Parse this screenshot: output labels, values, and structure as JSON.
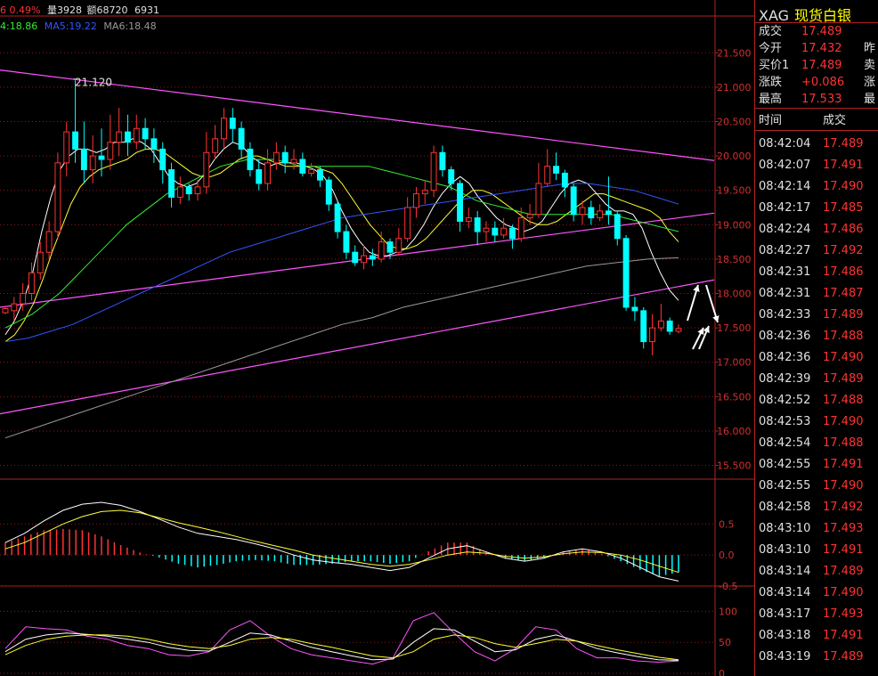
{
  "top_stats": {
    "chg": "6 0.49%",
    "vol": "量3928",
    "amt": "额68720",
    "extra": "6931"
  },
  "ma_line": {
    "ma4": "4:18.86",
    "ma5": "MA5:19.22",
    "ma6": "MA6:18.48"
  },
  "colors": {
    "up": "#ff3333",
    "down": "#00ffff",
    "trend": "#ff55ff",
    "ma_white": "#ffffff",
    "ma_yellow": "#ffff33",
    "ma_green": "#33ee33",
    "ma_blue": "#3355ff",
    "ma_gray": "#999999",
    "grid": "#8b1a1a"
  },
  "quote": {
    "symbol": "XAG",
    "name": "现货白银",
    "rows": [
      {
        "label": "成交",
        "value": "17.489",
        "ext": ""
      },
      {
        "label": "今开",
        "value": "17.432",
        "ext": "昨"
      },
      {
        "label": "买价1",
        "value": "17.489",
        "ext": "卖"
      },
      {
        "label": "涨跌",
        "value": "+0.086",
        "ext": "涨"
      },
      {
        "label": "最高",
        "value": "17.533",
        "ext": "最"
      }
    ]
  },
  "ticks_header": {
    "time": "时间",
    "price": "成交"
  },
  "ticks": [
    {
      "t": "08:42:04",
      "p": "17.489"
    },
    {
      "t": "08:42:07",
      "p": "17.491"
    },
    {
      "t": "08:42:14",
      "p": "17.490"
    },
    {
      "t": "08:42:17",
      "p": "17.485"
    },
    {
      "t": "08:42:24",
      "p": "17.486"
    },
    {
      "t": "08:42:27",
      "p": "17.492"
    },
    {
      "t": "08:42:31",
      "p": "17.486"
    },
    {
      "t": "08:42:31",
      "p": "17.487"
    },
    {
      "t": "08:42:33",
      "p": "17.489"
    },
    {
      "t": "08:42:36",
      "p": "17.488"
    },
    {
      "t": "08:42:36",
      "p": "17.490"
    },
    {
      "t": "08:42:39",
      "p": "17.489"
    },
    {
      "t": "08:42:52",
      "p": "17.488"
    },
    {
      "t": "08:42:53",
      "p": "17.490"
    },
    {
      "t": "08:42:54",
      "p": "17.488"
    },
    {
      "t": "08:42:55",
      "p": "17.491"
    },
    {
      "t": "08:42:55",
      "p": "17.490"
    },
    {
      "t": "08:42:58",
      "p": "17.492"
    },
    {
      "t": "08:43:10",
      "p": "17.493"
    },
    {
      "t": "08:43:10",
      "p": "17.491"
    },
    {
      "t": "08:43:14",
      "p": "17.489"
    },
    {
      "t": "08:43:14",
      "p": "17.490"
    },
    {
      "t": "08:43:17",
      "p": "17.493"
    },
    {
      "t": "08:43:18",
      "p": "17.491"
    },
    {
      "t": "08:43:19",
      "p": "17.489"
    }
  ],
  "chart_data": [
    {
      "type": "candlestick",
      "ylim": [
        15.3,
        21.75
      ],
      "yticks": [
        "21.500",
        "21.000",
        "20.500",
        "20.000",
        "19.500",
        "19.000",
        "18.500",
        "18.000",
        "17.500",
        "17.000",
        "16.500",
        "16.000",
        "15.500"
      ],
      "ytick_values": [
        21.5,
        21.0,
        20.5,
        20.0,
        19.5,
        19.0,
        18.5,
        18.0,
        17.5,
        17.0,
        16.5,
        16.0,
        15.5
      ],
      "annotation": {
        "text": "21.120",
        "value": 21.12
      },
      "candles": [
        [
          17.72,
          17.78,
          17.82,
          17.7
        ],
        [
          17.75,
          17.85,
          17.95,
          17.6
        ],
        [
          17.85,
          18.0,
          18.15,
          17.75
        ],
        [
          18.0,
          18.3,
          18.45,
          17.9
        ],
        [
          18.3,
          18.6,
          18.75,
          18.2
        ],
        [
          18.6,
          18.9,
          19.05,
          18.5
        ],
        [
          18.9,
          19.9,
          20.05,
          18.8
        ],
        [
          19.9,
          20.35,
          20.5,
          19.7
        ],
        [
          20.35,
          20.1,
          21.1,
          19.9
        ],
        [
          20.1,
          19.8,
          20.5,
          19.6
        ],
        [
          19.8,
          20.0,
          20.3,
          19.6
        ],
        [
          20.0,
          19.95,
          20.4,
          19.7
        ],
        [
          19.95,
          20.2,
          20.6,
          19.8
        ],
        [
          20.2,
          20.35,
          20.7,
          20.0
        ],
        [
          20.35,
          20.2,
          20.6,
          20.0
        ],
        [
          20.2,
          20.4,
          20.6,
          20.1
        ],
        [
          20.4,
          20.25,
          20.55,
          20.1
        ],
        [
          20.25,
          20.1,
          20.4,
          19.9
        ],
        [
          20.1,
          19.8,
          20.2,
          19.6
        ],
        [
          19.8,
          19.4,
          19.9,
          19.25
        ],
        [
          19.4,
          19.55,
          19.7,
          19.3
        ],
        [
          19.55,
          19.45,
          19.6,
          19.35
        ],
        [
          19.45,
          19.55,
          19.65,
          19.35
        ],
        [
          19.55,
          20.05,
          20.35,
          19.45
        ],
        [
          20.05,
          20.25,
          20.45,
          19.95
        ],
        [
          20.25,
          20.55,
          20.7,
          20.1
        ],
        [
          20.55,
          20.4,
          20.7,
          20.2
        ],
        [
          20.4,
          20.1,
          20.5,
          19.95
        ],
        [
          20.1,
          19.8,
          20.2,
          19.7
        ],
        [
          19.8,
          19.6,
          19.95,
          19.5
        ],
        [
          19.6,
          19.9,
          20.1,
          19.5
        ],
        [
          19.9,
          20.05,
          20.2,
          19.8
        ],
        [
          20.05,
          19.9,
          20.15,
          19.75
        ],
        [
          19.9,
          19.95,
          20.1,
          19.8
        ],
        [
          19.95,
          19.75,
          20.05,
          19.7
        ],
        [
          19.75,
          19.8,
          19.9,
          19.7
        ],
        [
          19.8,
          19.65,
          19.85,
          19.55
        ],
        [
          19.65,
          19.3,
          19.7,
          19.2
        ],
        [
          19.3,
          18.9,
          19.35,
          18.8
        ],
        [
          18.9,
          18.6,
          19.0,
          18.5
        ],
        [
          18.6,
          18.45,
          18.7,
          18.4
        ],
        [
          18.45,
          18.55,
          18.7,
          18.35
        ],
        [
          18.55,
          18.5,
          18.65,
          18.4
        ],
        [
          18.5,
          18.75,
          18.9,
          18.45
        ],
        [
          18.75,
          18.6,
          18.8,
          18.5
        ],
        [
          18.6,
          18.8,
          18.95,
          18.55
        ],
        [
          18.8,
          19.25,
          19.4,
          18.75
        ],
        [
          19.25,
          19.45,
          19.55,
          19.1
        ],
        [
          19.45,
          19.5,
          19.65,
          19.3
        ],
        [
          19.5,
          20.05,
          20.15,
          19.4
        ],
        [
          20.05,
          19.8,
          20.15,
          19.7
        ],
        [
          19.8,
          19.6,
          19.85,
          19.5
        ],
        [
          19.6,
          19.05,
          19.65,
          18.9
        ],
        [
          19.05,
          19.1,
          19.25,
          18.95
        ],
        [
          19.1,
          18.9,
          19.2,
          18.7
        ],
        [
          18.9,
          18.95,
          19.05,
          18.75
        ],
        [
          18.95,
          18.85,
          19.05,
          18.75
        ],
        [
          18.85,
          18.95,
          19.1,
          18.8
        ],
        [
          18.95,
          18.8,
          19.0,
          18.65
        ],
        [
          18.8,
          19.1,
          19.25,
          18.75
        ],
        [
          19.1,
          19.15,
          19.3,
          19.0
        ],
        [
          19.15,
          19.6,
          19.9,
          19.1
        ],
        [
          19.6,
          19.85,
          20.1,
          19.55
        ],
        [
          19.85,
          19.75,
          20.05,
          19.65
        ],
        [
          19.75,
          19.55,
          19.8,
          19.4
        ],
        [
          19.55,
          19.15,
          19.6,
          19.05
        ],
        [
          19.15,
          19.25,
          19.35,
          19.0
        ],
        [
          19.25,
          19.1,
          19.35,
          19.0
        ],
        [
          19.1,
          19.2,
          19.3,
          19.05
        ],
        [
          19.2,
          19.15,
          19.7,
          19.0
        ],
        [
          19.15,
          18.8,
          19.2,
          18.7
        ],
        [
          18.8,
          17.8,
          18.85,
          17.75
        ],
        [
          17.8,
          17.75,
          17.95,
          17.6
        ],
        [
          17.75,
          17.3,
          17.8,
          17.2
        ],
        [
          17.3,
          17.5,
          17.7,
          17.1
        ],
        [
          17.5,
          17.6,
          17.85,
          17.45
        ],
        [
          17.6,
          17.45,
          17.65,
          17.4
        ],
        [
          17.45,
          17.49,
          17.55,
          17.42
        ]
      ],
      "ma_series": [
        {
          "values": [
            17.4,
            17.6,
            17.9,
            18.3,
            18.9,
            19.4,
            19.8,
            20.0,
            20.1,
            20.1,
            20.05,
            20.1,
            20.2,
            20.2,
            20.25,
            20.2,
            20.1,
            19.9,
            19.7,
            19.6,
            19.55,
            19.6,
            19.75,
            19.95,
            20.1,
            20.2,
            20.15,
            20.0,
            19.9,
            19.85,
            19.9,
            19.9,
            19.9,
            19.85,
            19.8,
            19.7,
            19.5,
            19.2,
            18.95,
            18.75,
            18.6,
            18.55,
            18.55,
            18.6,
            18.65,
            18.8,
            19.0,
            19.25,
            19.45,
            19.6,
            19.7,
            19.6,
            19.4,
            19.25,
            19.1,
            19.0,
            18.95,
            18.9,
            18.95,
            19.05,
            19.25,
            19.45,
            19.6,
            19.65,
            19.6,
            19.45,
            19.3,
            19.2,
            19.2,
            19.15,
            18.95,
            18.6,
            18.3,
            18.05,
            17.9
          ]
        },
        {
          "values": [
            17.3,
            17.4,
            17.6,
            17.85,
            18.2,
            18.6,
            18.95,
            19.3,
            19.55,
            19.7,
            19.8,
            19.85,
            19.9,
            19.95,
            20.05,
            20.1,
            20.1,
            20.05,
            19.95,
            19.85,
            19.75,
            19.7,
            19.7,
            19.75,
            19.85,
            19.95,
            20.0,
            20.0,
            19.95,
            19.9,
            19.85,
            19.85,
            19.85,
            19.85,
            19.8,
            19.75,
            19.6,
            19.4,
            19.2,
            19.0,
            18.85,
            18.7,
            18.65,
            18.65,
            18.7,
            18.8,
            18.95,
            19.1,
            19.25,
            19.4,
            19.5,
            19.5,
            19.45,
            19.35,
            19.25,
            19.15,
            19.05,
            19.0,
            19.0,
            19.05,
            19.15,
            19.25,
            19.35,
            19.45,
            19.45,
            19.4,
            19.35,
            19.3,
            19.25,
            19.2,
            19.1,
            18.9,
            18.75
          ]
        },
        {
          "values": [
            17.5,
            17.6,
            17.7,
            17.85,
            18.0,
            18.2,
            18.4,
            18.6,
            18.8,
            19.0,
            19.15,
            19.3,
            19.45,
            19.55,
            19.65,
            19.75,
            19.85,
            19.9,
            19.95,
            19.95,
            19.95,
            19.9,
            19.85,
            19.85,
            19.85,
            19.85,
            19.85,
            19.85,
            19.8,
            19.75,
            19.7,
            19.65,
            19.6,
            19.55,
            19.45,
            19.35,
            19.3,
            19.25,
            19.2,
            19.15,
            19.15,
            19.15,
            19.15,
            19.15,
            19.15,
            19.15,
            19.1,
            19.05,
            19.0,
            18.95,
            18.9
          ]
        },
        {
          "values": [
            17.3,
            17.35,
            17.45,
            17.55,
            17.7,
            17.85,
            18.0,
            18.15,
            18.3,
            18.45,
            18.6,
            18.7,
            18.8,
            18.9,
            19.0,
            19.1,
            19.15,
            19.2,
            19.25,
            19.3,
            19.35,
            19.4,
            19.45,
            19.5,
            19.55,
            19.6,
            19.6,
            19.55,
            19.5,
            19.4,
            19.3
          ]
        },
        {
          "values": [
            15.9,
            16.05,
            16.2,
            16.35,
            16.5,
            16.65,
            16.8,
            16.95,
            17.1,
            17.25,
            17.4,
            17.55,
            17.65,
            17.8,
            17.9,
            18.0,
            18.1,
            18.2,
            18.3,
            18.4,
            18.45,
            18.5,
            18.52
          ]
        }
      ],
      "trendlines": [
        {
          "from": [
            0,
            21.25
          ],
          "to": [
            77,
            20.0
          ]
        },
        {
          "from": [
            0,
            17.8
          ],
          "to": [
            77,
            19.1
          ]
        },
        {
          "from": [
            0,
            16.25
          ],
          "to": [
            77,
            18.1
          ]
        }
      ]
    },
    {
      "type": "macd",
      "ylim": [
        -0.5,
        0.95
      ],
      "yticks": [
        "0.5",
        "0.0",
        "-0.5"
      ],
      "ytick_values": [
        0.5,
        0.0,
        -0.5
      ],
      "dif": [
        0.2,
        0.35,
        0.55,
        0.72,
        0.82,
        0.85,
        0.8,
        0.7,
        0.58,
        0.45,
        0.35,
        0.3,
        0.25,
        0.18,
        0.1,
        0.0,
        -0.08,
        -0.12,
        -0.15,
        -0.2,
        -0.25,
        -0.2,
        -0.05,
        0.1,
        0.15,
        0.05,
        -0.05,
        -0.1,
        -0.05,
        0.05,
        0.1,
        0.05,
        -0.05,
        -0.2,
        -0.35,
        -0.42
      ],
      "dea": [
        0.1,
        0.2,
        0.35,
        0.5,
        0.62,
        0.7,
        0.72,
        0.68,
        0.6,
        0.52,
        0.45,
        0.38,
        0.3,
        0.22,
        0.15,
        0.08,
        0.0,
        -0.05,
        -0.1,
        -0.15,
        -0.18,
        -0.15,
        -0.08,
        0.0,
        0.05,
        0.03,
        -0.02,
        -0.05,
        -0.03,
        0.02,
        0.05,
        0.04,
        0.0,
        -0.08,
        -0.18,
        -0.28
      ],
      "hist": [
        0.2,
        0.3,
        0.4,
        0.42,
        0.4,
        0.3,
        0.16,
        0.04,
        -0.04,
        -0.14,
        -0.2,
        -0.16,
        -0.1,
        -0.08,
        -0.1,
        -0.16,
        -0.16,
        -0.14,
        -0.1,
        -0.1,
        -0.14,
        -0.1,
        0.06,
        0.2,
        0.2,
        0.04,
        -0.06,
        -0.1,
        -0.04,
        0.06,
        0.1,
        0.02,
        -0.1,
        -0.24,
        -0.34,
        -0.28
      ]
    },
    {
      "type": "kdj",
      "ylim": [
        0,
        115
      ],
      "yticks": [
        "100",
        "50",
        "0"
      ],
      "ytick_values": [
        100,
        50,
        0
      ],
      "k": [
        40,
        75,
        72,
        70,
        60,
        55,
        45,
        40,
        30,
        28,
        35,
        70,
        85,
        60,
        40,
        30,
        25,
        20,
        15,
        25,
        85,
        98,
        65,
        35,
        20,
        40,
        75,
        70,
        40,
        25,
        25,
        20,
        18,
        20
      ],
      "d": [
        35,
        55,
        62,
        65,
        63,
        60,
        55,
        50,
        42,
        37,
        36,
        50,
        65,
        62,
        52,
        42,
        35,
        28,
        22,
        23,
        50,
        72,
        70,
        52,
        35,
        38,
        55,
        62,
        52,
        40,
        33,
        27,
        22,
        21
      ],
      "j": [
        30,
        45,
        55,
        60,
        62,
        62,
        60,
        55,
        48,
        43,
        40,
        45,
        55,
        58,
        55,
        48,
        42,
        35,
        28,
        25,
        35,
        55,
        62,
        58,
        48,
        42,
        48,
        55,
        52,
        45,
        38,
        32,
        26,
        22
      ]
    }
  ]
}
